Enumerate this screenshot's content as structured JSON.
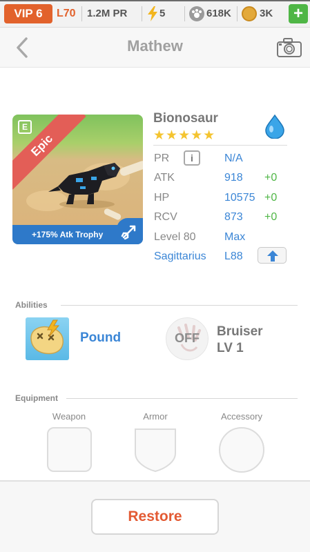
{
  "topbar": {
    "vip": "VIP 6",
    "level": "L70",
    "pr": "1.2M PR",
    "energy": "5",
    "paw_currency": "618K",
    "coins": "3K",
    "plus": "+",
    "icons": {
      "energy": "lightning-icon",
      "paw": "paw-icon",
      "coin": "coin-icon"
    }
  },
  "header": {
    "title": "Mathew"
  },
  "creature": {
    "name": "Bionosaur",
    "rarity": "Epic",
    "stars": "★★★★★",
    "element_badge": "E",
    "trophy": "+175% Atk Trophy",
    "stats": [
      {
        "label": "PR",
        "value": "N/A",
        "plus": ""
      },
      {
        "label": "ATK",
        "value": "918",
        "plus": "+0"
      },
      {
        "label": "HP",
        "value": "10575",
        "plus": "+0"
      },
      {
        "label": "RCV",
        "value": "873",
        "plus": "+0"
      },
      {
        "label": "Level 80",
        "value": "Max",
        "plus": ""
      }
    ],
    "info_glyph": "i",
    "zodiac": {
      "name": "Sagittarius",
      "level": "L88"
    }
  },
  "abilities": {
    "title": "Abilities",
    "active": {
      "name": "Pound"
    },
    "passive": {
      "status": "OFF",
      "name": "Bruiser",
      "level": "LV 1"
    }
  },
  "equipment": {
    "title": "Equipment",
    "slots": [
      "Weapon",
      "Armor",
      "Accessory"
    ]
  },
  "actions": {
    "restore": "Restore"
  },
  "colors": {
    "accent_orange": "#e2622c",
    "link_blue": "#3b86d6",
    "green": "#4fb646",
    "star_gold": "#f4c430"
  }
}
